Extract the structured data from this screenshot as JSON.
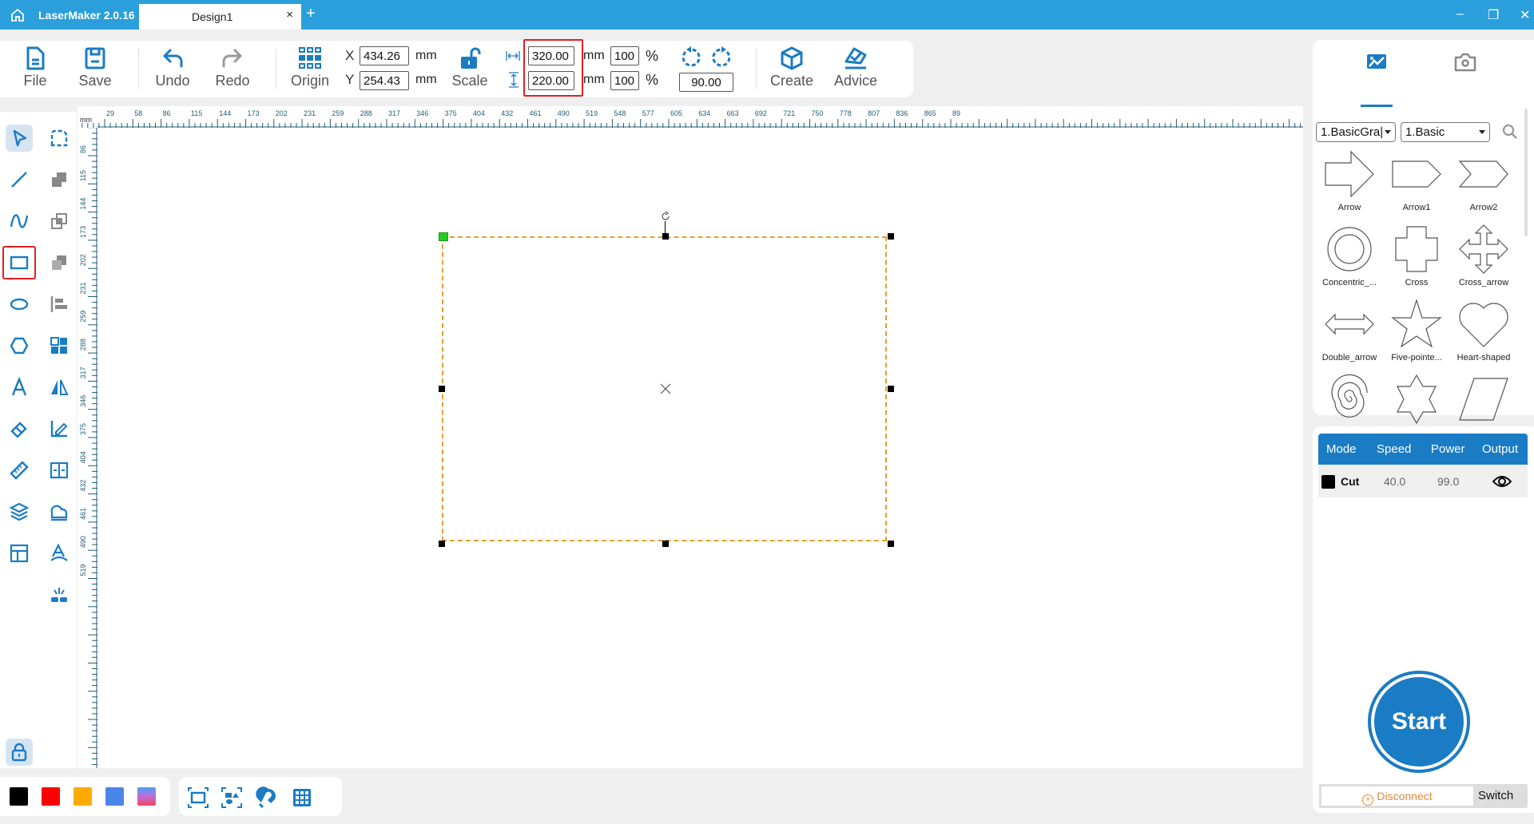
{
  "titlebar": {
    "app_name": "LaserMaker 2.0.16",
    "tab_label": "Design1",
    "tab_close": "×",
    "new_tab": "+",
    "minimize": "–",
    "restore": "❐",
    "close": "✕"
  },
  "toolbar": {
    "file": "File",
    "save": "Save",
    "undo": "Undo",
    "redo": "Redo",
    "origin": "Origin",
    "scale": "Scale",
    "create": "Create",
    "advice": "Advice",
    "x_label": "X",
    "y_label": "Y",
    "x_value": "434.26",
    "y_value": "254.43",
    "unit": "mm",
    "width_value": "320.00",
    "height_value": "220.00",
    "width_percent": "100",
    "height_percent": "100",
    "percent": "%",
    "rotation": "90.00"
  },
  "ruler": {
    "unit": "mm",
    "top_ticks": [
      "29",
      "58",
      "86",
      "115",
      "144",
      "173",
      "202",
      "231",
      "259",
      "288",
      "317",
      "346",
      "375",
      "404",
      "432",
      "461",
      "490",
      "519",
      "548",
      "577",
      "605",
      "634",
      "663",
      "692",
      "721",
      "750",
      "778",
      "807",
      "836",
      "865",
      "89"
    ],
    "left_ticks": [
      "86",
      "115",
      "144",
      "173",
      "202",
      "231",
      "259",
      "288",
      "317",
      "346",
      "375",
      "404",
      "432",
      "461",
      "490",
      "519"
    ]
  },
  "left_tools": [
    {
      "name": "select-tool",
      "active": true
    },
    {
      "name": "node-edit-tool"
    },
    {
      "name": "line-tool"
    },
    {
      "name": "union-tool"
    },
    {
      "name": "curve-tool"
    },
    {
      "name": "intersect-tool"
    },
    {
      "name": "rectangle-tool",
      "boxed": true
    },
    {
      "name": "subtract-tool"
    },
    {
      "name": "ellipse-tool"
    },
    {
      "name": "align-tool"
    },
    {
      "name": "polygon-tool"
    },
    {
      "name": "array-tool"
    },
    {
      "name": "text-tool"
    },
    {
      "name": "mirror-tool"
    },
    {
      "name": "eraser-tool"
    },
    {
      "name": "measure-edit-tool"
    },
    {
      "name": "ruler-tool"
    },
    {
      "name": "fit-tool"
    },
    {
      "name": "layers-tool"
    },
    {
      "name": "offset-tool"
    },
    {
      "name": "layout-tool"
    },
    {
      "name": "text-path-tool"
    },
    {
      "name": "laser-tool"
    }
  ],
  "colors": {
    "swatches": [
      "#000000",
      "#ff0000",
      "#ffaa00",
      "#4a86e8",
      "gradient"
    ],
    "accent": "#1a7cc4",
    "titlebar": "#2a9fdb",
    "selection": "#e0a030",
    "origin_handle": "#22cc22"
  },
  "panel": {
    "category_select": "1.BasicGra|",
    "subcategory_select": "1.Basic",
    "shapes": [
      "Arrow",
      "Arrow1",
      "Arrow2",
      "Concentric_...",
      "Cross",
      "Cross_arrow",
      "Double_arrow",
      "Five-pointe...",
      "Heart-shaped",
      "Helical_line",
      "Hexagonal_...",
      "Parallelogram"
    ]
  },
  "layers": {
    "headers": [
      "Mode",
      "Speed",
      "Power",
      "Output"
    ],
    "rows": [
      {
        "color": "#000000",
        "mode": "Cut",
        "speed": "40.0",
        "power": "99.0",
        "output": "visible"
      }
    ]
  },
  "actions": {
    "start": "Start",
    "disconnect": "Disconnect",
    "switch": "Switch"
  }
}
